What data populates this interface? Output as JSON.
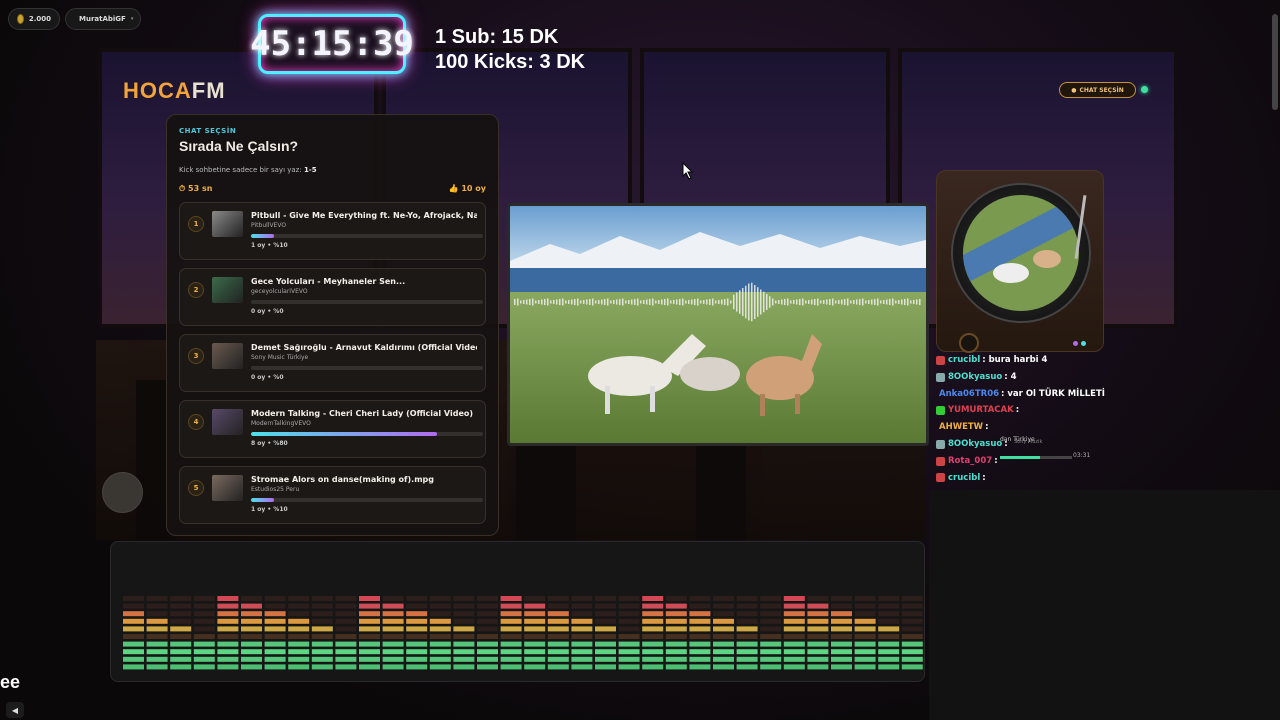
{
  "top": {
    "coins": "2.000",
    "username": "MuratAbiGF"
  },
  "timer": "45:15:39",
  "sub_info": {
    "line1": "1 Sub: 15 DK",
    "line2": "100 Kicks: 3 DK"
  },
  "logo": {
    "part1": "HOCA",
    "part2": "FM"
  },
  "chat_choose_pill": "CHAT SEÇSİN",
  "poll": {
    "kicker": "CHAT SEÇSİN",
    "title": "Sırada Ne Çalsın?",
    "hint_prefix": "Kick sohbetine sadece bir sayı yaz: ",
    "hint_range": "1-5",
    "time_left": "53 sn",
    "total_votes": "10 oy",
    "items": [
      {
        "num": "1",
        "title": "Pitbull - Give Me Everything ft. Ne-Yo, Afrojack, Nayer",
        "channel": "PitbullVEVO",
        "votes": "1 oy • %10",
        "pct": 10,
        "thumb": "#8a8a8a"
      },
      {
        "num": "2",
        "title": "Gece Yolcuları - Meyhaneler Sen...",
        "channel": "geceyolculariVEVO",
        "votes": "0 oy • %0",
        "pct": 0,
        "thumb": "#3b6b4a"
      },
      {
        "num": "3",
        "title": "Demet Sağıroğlu - Arnavut Kaldırımı (Official Video)",
        "channel": "Sony Music Türkiye",
        "votes": "0 oy • %0",
        "pct": 0,
        "thumb": "#6a5a50"
      },
      {
        "num": "4",
        "title": "Modern Talking - Cheri Cheri Lady (Official Video)",
        "channel": "ModernTalkingVEVO",
        "votes": "8 oy • %80",
        "pct": 80,
        "thumb": "#5a4a6a"
      },
      {
        "num": "5",
        "title": "Stromae Alors on danse(making of).mpg",
        "channel": "Estudios25 Peru",
        "votes": "1 oy • %10",
        "pct": 10,
        "thumb": "#7a6a60"
      }
    ]
  },
  "chat": [
    {
      "user": "crucibl",
      "color": "#4de0d0",
      "badge": "#c44",
      "msg": ": bura harbi 4"
    },
    {
      "user": "8OOkyasuo",
      "color": "#4de0d0",
      "badge": "#8aa",
      "msg": ": 4"
    },
    {
      "user": "Anka06TR06",
      "color": "#4a8af0",
      "badge": "",
      "msg": ": var Ol TÜRK MİLLETİ"
    },
    {
      "user": "YUMURTACAK",
      "color": "#e04050",
      "badge": "#3c3",
      "msg": ":"
    },
    {
      "user": "AHWETW",
      "color": "#f0b040",
      "badge": "",
      "msg": ":"
    },
    {
      "user": "8OOkyasuo",
      "color": "#4de0d0",
      "badge": "#8aa",
      "msg": ":"
    },
    {
      "user": "Rota_007",
      "color": "#e04070",
      "badge": "#c44",
      "msg": ":"
    },
    {
      "user": "crucibl",
      "color": "#4de0d0",
      "badge": "#c44",
      "msg": ":"
    }
  ],
  "now_playing": {
    "line1": "dan Türkiye",
    "line2": "Sony Müzik",
    "time": "03:31"
  },
  "corner_text": "ee",
  "colors": {
    "accent": "#f2a33a",
    "teal": "#4ec9d9",
    "purple": "#b06af0"
  }
}
